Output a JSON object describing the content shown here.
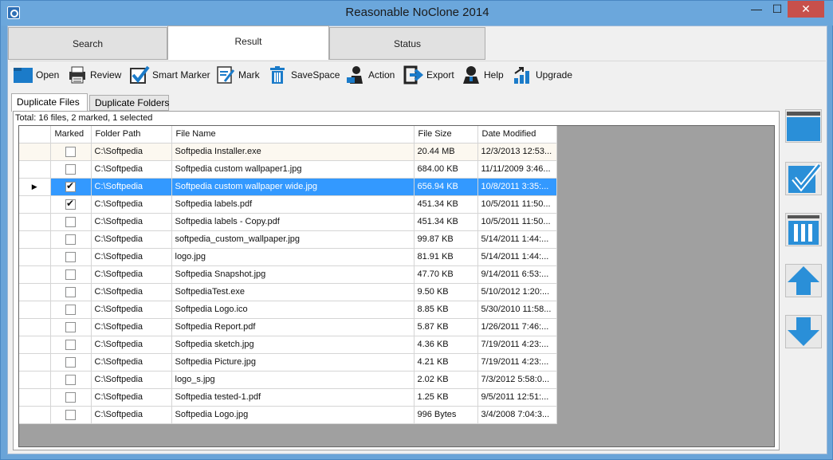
{
  "window": {
    "title": "Reasonable NoClone 2014",
    "min": "—",
    "max": "☐",
    "close": "✕"
  },
  "main_tabs": [
    {
      "label": "Search"
    },
    {
      "label": "Result"
    },
    {
      "label": "Status"
    }
  ],
  "toolbar": [
    {
      "label": "Open",
      "icon": "folder-icon"
    },
    {
      "label": "Review",
      "icon": "printer-icon"
    },
    {
      "label": "Smart Marker",
      "icon": "check-icon"
    },
    {
      "label": "Mark",
      "icon": "pen-icon"
    },
    {
      "label": "SaveSpace",
      "icon": "trash-icon"
    },
    {
      "label": "Action",
      "icon": "person-icon"
    },
    {
      "label": "Export",
      "icon": "export-icon"
    },
    {
      "label": "Help",
      "icon": "help-icon"
    },
    {
      "label": "Upgrade",
      "icon": "upgrade-icon"
    }
  ],
  "sub_tabs": [
    {
      "label": "Duplicate Files"
    },
    {
      "label": "Duplicate Folders"
    }
  ],
  "status_text": "Total: 16 files, 2 marked, 1 selected",
  "columns": [
    "Marked",
    "Folder Path",
    "File Name",
    "File Size",
    "Date Modified"
  ],
  "rows": [
    {
      "marked": false,
      "path": "C:\\Softpedia",
      "name": "Softpedia Installer.exe",
      "size": "20.44 MB",
      "date": "12/3/2013 12:53..."
    },
    {
      "marked": false,
      "path": "C:\\Softpedia",
      "name": "Softpedia custom wallpaper1.jpg",
      "size": "684.00 KB",
      "date": "11/11/2009 3:46..."
    },
    {
      "marked": true,
      "path": "C:\\Softpedia",
      "name": "Softpedia custom wallpaper wide.jpg",
      "size": "656.94 KB",
      "date": "10/8/2011 3:35:..."
    },
    {
      "marked": true,
      "path": "C:\\Softpedia",
      "name": "Softpedia labels.pdf",
      "size": "451.34 KB",
      "date": "10/5/2011 11:50..."
    },
    {
      "marked": false,
      "path": "C:\\Softpedia",
      "name": "Softpedia labels - Copy.pdf",
      "size": "451.34 KB",
      "date": "10/5/2011 11:50..."
    },
    {
      "marked": false,
      "path": "C:\\Softpedia",
      "name": "softpedia_custom_wallpaper.jpg",
      "size": "99.87 KB",
      "date": "5/14/2011 1:44:..."
    },
    {
      "marked": false,
      "path": "C:\\Softpedia",
      "name": "logo.jpg",
      "size": "81.91 KB",
      "date": "5/14/2011 1:44:..."
    },
    {
      "marked": false,
      "path": "C:\\Softpedia",
      "name": "Softpedia Snapshot.jpg",
      "size": "47.70 KB",
      "date": "9/14/2011 6:53:..."
    },
    {
      "marked": false,
      "path": "C:\\Softpedia",
      "name": "SoftpediaTest.exe",
      "size": "9.50 KB",
      "date": "5/10/2012 1:20:..."
    },
    {
      "marked": false,
      "path": "C:\\Softpedia",
      "name": "Softpedia Logo.ico",
      "size": "8.85 KB",
      "date": "5/30/2010 11:58..."
    },
    {
      "marked": false,
      "path": "C:\\Softpedia",
      "name": "Softpedia Report.pdf",
      "size": "5.87 KB",
      "date": "1/26/2011 7:46:..."
    },
    {
      "marked": false,
      "path": "C:\\Softpedia",
      "name": "Softpedia sketch.jpg",
      "size": "4.36 KB",
      "date": "7/19/2011 4:23:..."
    },
    {
      "marked": false,
      "path": "C:\\Softpedia",
      "name": "Softpedia Picture.jpg",
      "size": "4.21 KB",
      "date": "7/19/2011 4:23:..."
    },
    {
      "marked": false,
      "path": "C:\\Softpedia",
      "name": "logo_s.jpg",
      "size": "2.02 KB",
      "date": "7/3/2012 5:58:0..."
    },
    {
      "marked": false,
      "path": "C:\\Softpedia",
      "name": "Softpedia tested-1.pdf",
      "size": "1.25 KB",
      "date": "9/5/2011 12:51:..."
    },
    {
      "marked": false,
      "path": "C:\\Softpedia",
      "name": "Softpedia Logo.jpg",
      "size": "996 Bytes",
      "date": "3/4/2008 7:04:3..."
    }
  ],
  "selected_row": 2,
  "side_buttons": [
    {
      "icon": "folder-panel-icon"
    },
    {
      "icon": "check-all-icon"
    },
    {
      "icon": "trash-panel-icon"
    },
    {
      "icon": "arrow-up-icon"
    },
    {
      "icon": "arrow-down-icon"
    }
  ],
  "colors": {
    "accent": "#2a8fd8",
    "selection": "#3399ff",
    "titlebar": "#6ba7dc"
  }
}
